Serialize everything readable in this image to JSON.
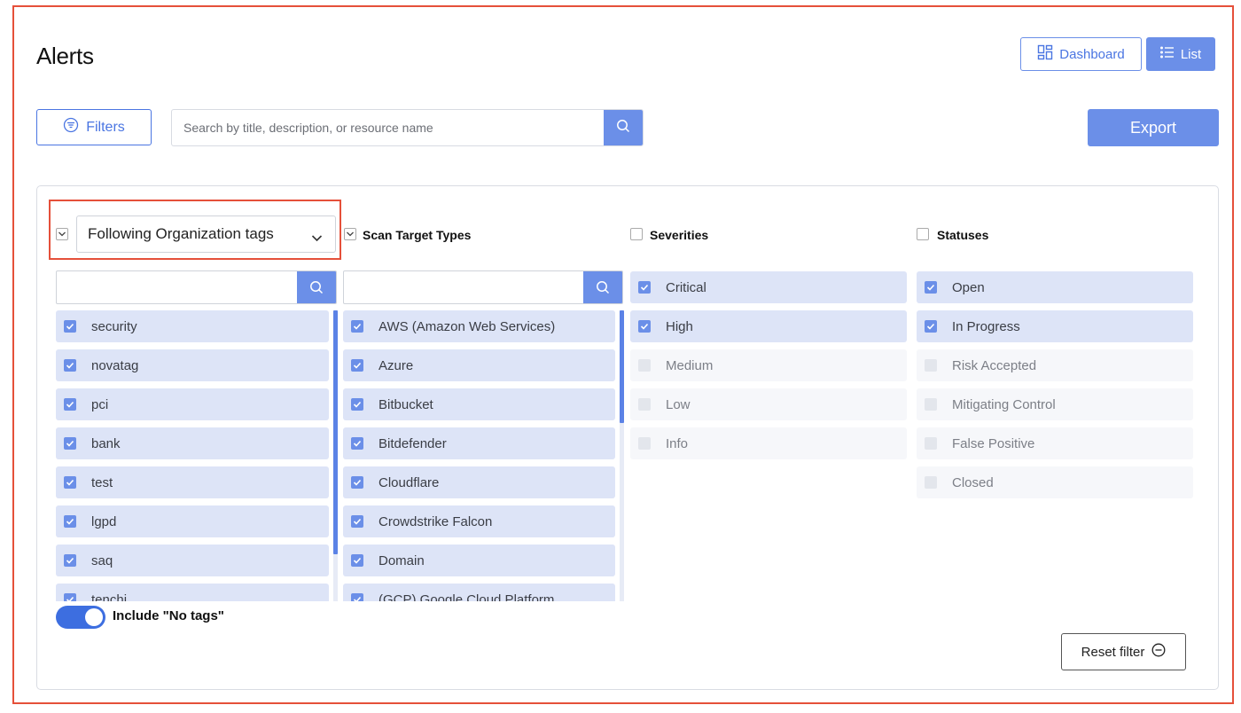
{
  "page": {
    "title": "Alerts"
  },
  "view_toggle": {
    "dashboard_label": "Dashboard",
    "list_label": "List"
  },
  "toolbar": {
    "filters_label": "Filters",
    "search_placeholder": "Search by title, description, or resource name",
    "export_label": "Export"
  },
  "filters": {
    "tags": {
      "selected_mode": "Following Organization tags",
      "items": [
        {
          "label": "security",
          "checked": true
        },
        {
          "label": "novatag",
          "checked": true
        },
        {
          "label": "pci",
          "checked": true
        },
        {
          "label": "bank",
          "checked": true
        },
        {
          "label": "test",
          "checked": true
        },
        {
          "label": "lgpd",
          "checked": true
        },
        {
          "label": "saq",
          "checked": true
        },
        {
          "label": "tenchi",
          "checked": true
        }
      ],
      "include_no_tags_label": "Include \"No tags\"",
      "include_no_tags_on": true
    },
    "scan_target_types": {
      "heading": "Scan Target Types",
      "items": [
        {
          "label": "AWS (Amazon Web Services)",
          "checked": true
        },
        {
          "label": "Azure",
          "checked": true
        },
        {
          "label": "Bitbucket",
          "checked": true
        },
        {
          "label": "Bitdefender",
          "checked": true
        },
        {
          "label": "Cloudflare",
          "checked": true
        },
        {
          "label": "Crowdstrike Falcon",
          "checked": true
        },
        {
          "label": "Domain",
          "checked": true
        },
        {
          "label": "(GCP) Google Cloud Platform",
          "checked": true
        }
      ]
    },
    "severities": {
      "heading": "Severities",
      "items": [
        {
          "label": "Critical",
          "checked": true
        },
        {
          "label": "High",
          "checked": true
        },
        {
          "label": "Medium",
          "checked": false
        },
        {
          "label": "Low",
          "checked": false
        },
        {
          "label": "Info",
          "checked": false
        }
      ]
    },
    "statuses": {
      "heading": "Statuses",
      "items": [
        {
          "label": "Open",
          "checked": true
        },
        {
          "label": "In Progress",
          "checked": true
        },
        {
          "label": "Risk Accepted",
          "checked": false
        },
        {
          "label": "Mitigating Control",
          "checked": false
        },
        {
          "label": "False Positive",
          "checked": false
        },
        {
          "label": "Closed",
          "checked": false
        }
      ]
    },
    "reset_label": "Reset filter"
  },
  "colors": {
    "accent": "#6b8fe8",
    "accent_dark": "#4a75e2",
    "highlight": "#e5503a",
    "item_bg": "#dde4f7"
  }
}
